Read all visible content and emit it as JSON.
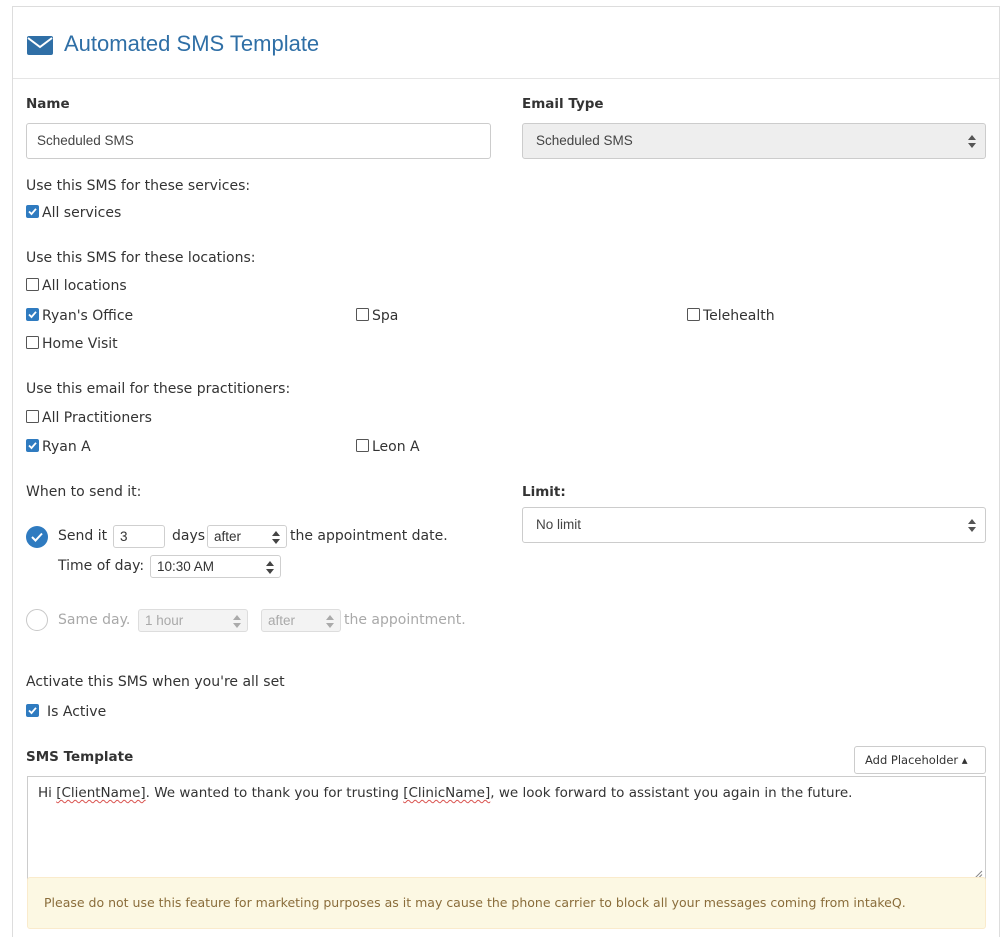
{
  "header": {
    "title": "Automated SMS Template",
    "icon": "envelope-icon",
    "accent": "#2f6fa6"
  },
  "name": {
    "label": "Name",
    "value": "Scheduled SMS"
  },
  "email_type": {
    "label": "Email Type",
    "value": "Scheduled SMS"
  },
  "services": {
    "heading": "Use this SMS for these services:",
    "all_label": "All services",
    "all_checked": true
  },
  "locations": {
    "heading": "Use this SMS for these locations:",
    "items": [
      {
        "label": "All locations",
        "checked": false
      },
      {
        "label": "Ryan's Office",
        "checked": true
      },
      {
        "label": "Spa",
        "checked": false
      },
      {
        "label": "Telehealth",
        "checked": false
      },
      {
        "label": "Home Visit",
        "checked": false
      }
    ]
  },
  "practitioners": {
    "heading": "Use this email for these practitioners:",
    "items": [
      {
        "label": "All Practitioners",
        "checked": false
      },
      {
        "label": "Ryan A",
        "checked": true
      },
      {
        "label": "Leon A",
        "checked": false
      }
    ]
  },
  "when": {
    "heading": "When to send it:",
    "send_label": "Send it",
    "days_value": "3",
    "days_label": "days",
    "direction": "after",
    "after_text": "the appointment date.",
    "time_label": "Time of day:",
    "time_value": "10:30 AM",
    "same_day_label": "Same day.",
    "same_day_offset": "1 hour",
    "same_day_direction": "after",
    "same_day_after": "the appointment.",
    "selected_option": "send-it"
  },
  "limit": {
    "label": "Limit:",
    "value": "No limit"
  },
  "activate": {
    "heading": "Activate this SMS when you're all set",
    "checkbox_label": "Is Active",
    "checked": true
  },
  "template": {
    "label": "SMS Template",
    "add_placeholder_label": "Add Placeholder ▴",
    "text_part1": "Hi ",
    "token1": "[ClientName]",
    "text_part2": ". We wanted to thank you for trusting ",
    "token2": "[ClinicName]",
    "text_part3": ", we look forward to assistant you again in the future."
  },
  "warning": "Please do not use this feature for marketing purposes as it may cause the phone carrier to block all your messages coming from intakeQ.",
  "colors": {
    "checkbox": "#2f7bc0",
    "warning_bg": "#fcf8e3",
    "warning_text": "#8a6d3b"
  }
}
